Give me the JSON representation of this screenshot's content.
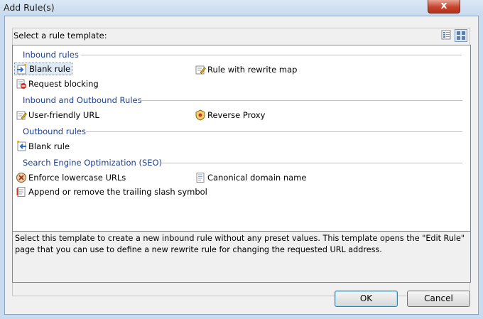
{
  "window": {
    "title": "Add Rule(s)",
    "close_glyph": "x"
  },
  "prompt": "Select a rule template:",
  "view_buttons": [
    {
      "name": "details-view-icon"
    },
    {
      "name": "tiles-view-icon",
      "active": true
    }
  ],
  "groups": [
    {
      "header": "Inbound rules",
      "items": [
        {
          "label": "Blank rule",
          "icon": "inbound-rule-icon",
          "selected": true
        },
        {
          "label": "Rule with rewrite map",
          "icon": "rewrite-map-icon"
        },
        {
          "label": "Request blocking",
          "icon": "block-icon"
        }
      ]
    },
    {
      "header": "Inbound and Outbound Rules",
      "items": [
        {
          "label": "User-friendly URL",
          "icon": "edit-url-icon"
        },
        {
          "label": "Reverse Proxy",
          "icon": "proxy-icon"
        }
      ]
    },
    {
      "header": "Outbound rules",
      "items": [
        {
          "label": "Blank rule",
          "icon": "outbound-rule-icon"
        }
      ]
    },
    {
      "header": "Search Engine Optimization (SEO)",
      "items": [
        {
          "label": "Enforce lowercase URLs",
          "icon": "lowercase-icon"
        },
        {
          "label": "Canonical domain name",
          "icon": "canonical-icon"
        },
        {
          "label": "Append or remove the trailing slash symbol",
          "icon": "slash-icon"
        }
      ]
    }
  ],
  "description": "Select this template to create a new inbound rule without any preset values. This template opens the \"Edit Rule\" page that you can use to define a new rewrite rule for changing the requested URL address.",
  "buttons": {
    "ok": "OK",
    "cancel": "Cancel"
  },
  "colors": {
    "group_header": "#1e3e90",
    "selection": "#dfeaf7"
  }
}
